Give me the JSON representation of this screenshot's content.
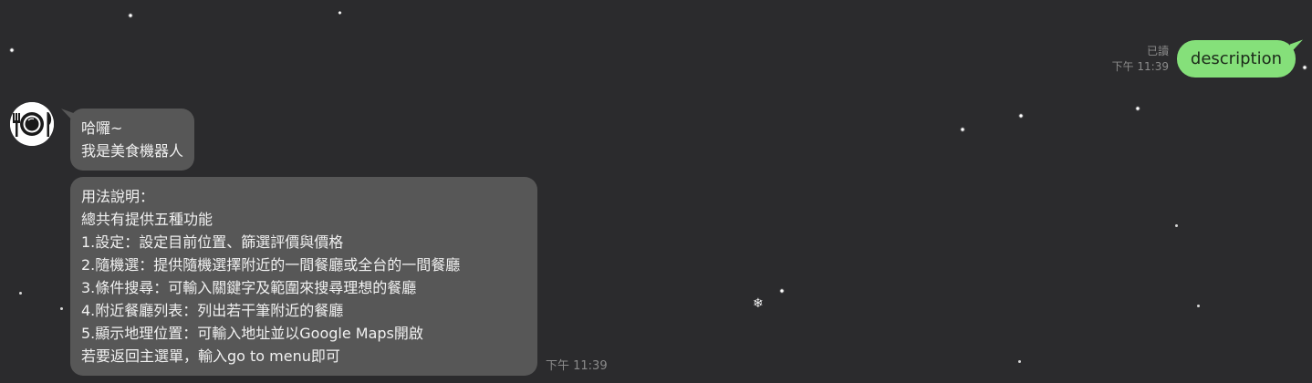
{
  "outgoing": {
    "read_label": "已讀",
    "time": "下午 11:39",
    "text": "description",
    "bubble_color": "#85e07a"
  },
  "bot": {
    "avatar_icon": "plate-with-utensils-icon",
    "greeting_lines": [
      "哈囉~",
      "我是美食機器人"
    ],
    "usage_lines": [
      "用法說明：",
      "總共有提供五種功能",
      "1.設定：設定目前位置、篩選評價與價格",
      "2.隨機選：提供隨機選擇附近的一間餐廳或全台的一間餐廳",
      "3.條件搜尋：可輸入關鍵字及範圍來搜尋理想的餐廳",
      "4.附近餐廳列表：列出若干筆附近的餐廳",
      "5.顯示地理位置：可輸入地址並以Google Maps開啟",
      "若要返回主選單，輸入go to menu即可"
    ],
    "time": "下午 11:39",
    "bubble_color": "#575757"
  },
  "theme": {
    "background": "#2b2b2d",
    "meta_text": "#8b8b8b",
    "decoration": "snowfall"
  }
}
